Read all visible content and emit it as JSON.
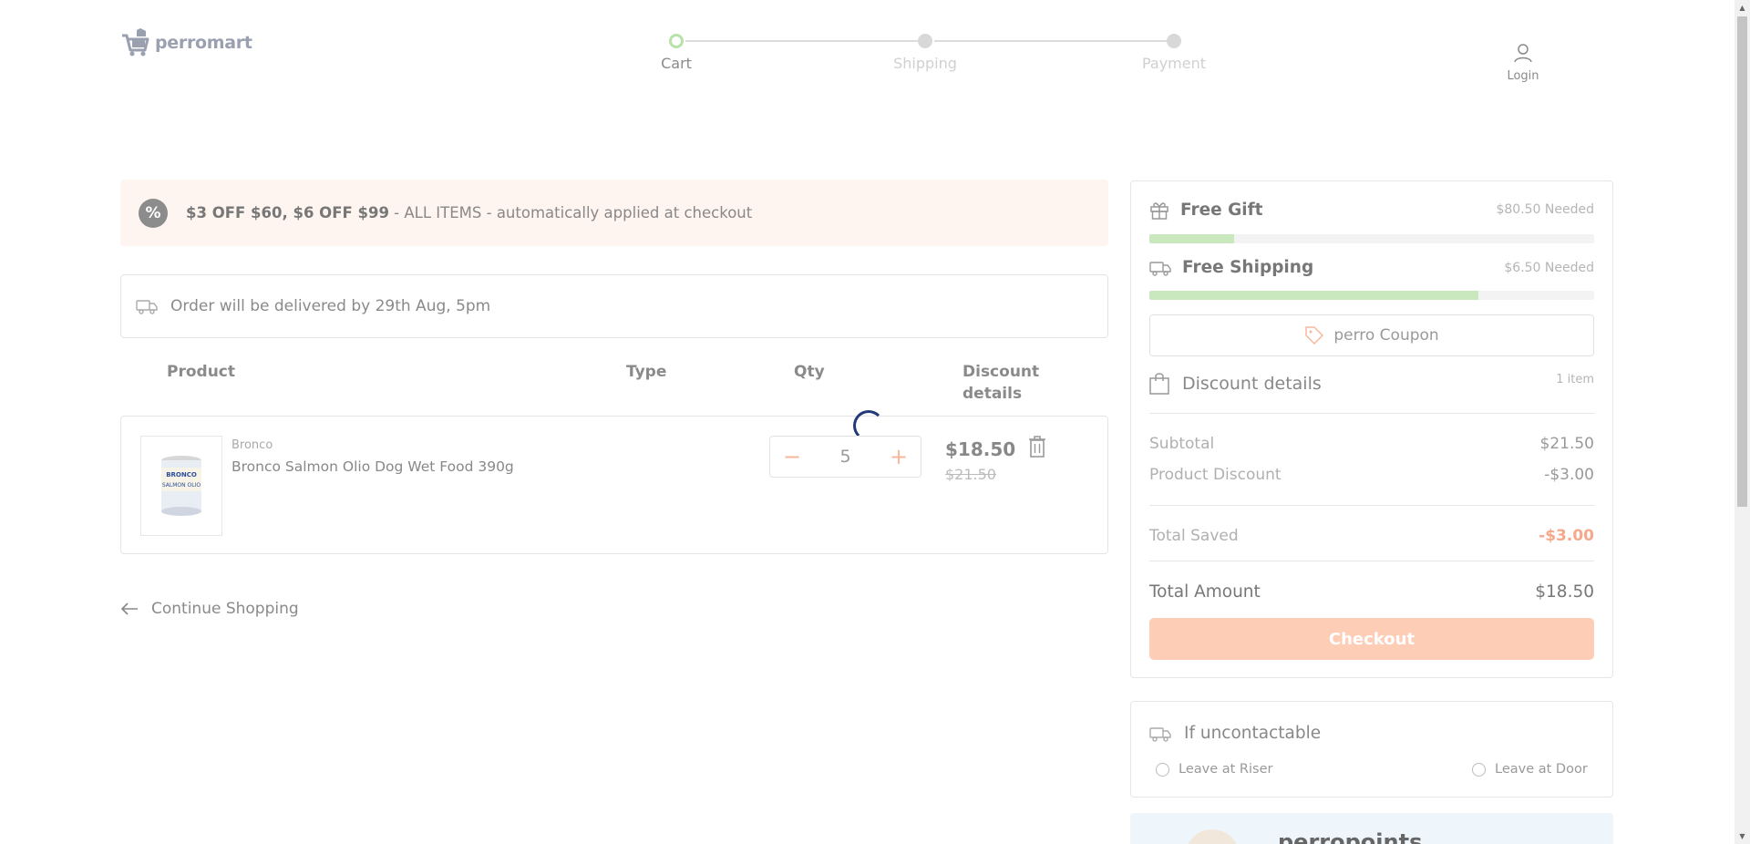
{
  "brand": {
    "name": "perromart"
  },
  "stepper": {
    "steps": [
      {
        "label": "Cart",
        "active": true
      },
      {
        "label": "Shipping",
        "active": false
      },
      {
        "label": "Payment",
        "active": false
      }
    ]
  },
  "header": {
    "login_label": "Login"
  },
  "promo": {
    "icon": "percent-icon",
    "bold_text": "$3 OFF $60, $6 OFF $99",
    "text": " - ALL ITEMS - automatically applied at checkout"
  },
  "delivery": {
    "icon": "truck-icon",
    "text": "Order will be delivered by 29th Aug, 5pm"
  },
  "cart_table": {
    "columns": [
      "Product",
      "Type",
      "Qty",
      "Discount details"
    ]
  },
  "cart_items": [
    {
      "brand": "Bronco",
      "name": "Bronco Salmon Olio Dog Wet Food 390g",
      "qty": "5",
      "price": "$18.50",
      "old_price": "$21.50",
      "image_label": "BRONCO SALMON OLIO"
    }
  ],
  "continue": {
    "label": "Continue Shopping"
  },
  "goals": [
    {
      "icon": "gift-icon",
      "title": "Free Gift",
      "needed": "$80.50 Needed",
      "progress": 0.19
    },
    {
      "icon": "truck-icon",
      "title": "Free Shipping",
      "needed": "$6.50 Needed",
      "progress": 0.74
    }
  ],
  "coupon": {
    "label": "perro Coupon"
  },
  "discount": {
    "title": "Discount details",
    "count": "1 item",
    "subtotal_label": "Subtotal",
    "subtotal": "$21.50",
    "product_discount_label": "Product Discount",
    "product_discount": "-$3.00",
    "total_saved_label": "Total Saved",
    "total_saved": "-$3.00",
    "total_label": "Total Amount",
    "total": "$18.50",
    "checkout_label": "Checkout"
  },
  "uncontactable": {
    "title": "If uncontactable",
    "options": [
      "Leave at Riser",
      "Leave at Door"
    ]
  },
  "points": {
    "title": "perropoints"
  },
  "colors": {
    "accent": "#fdcdb6",
    "progress": "#c9e8bd",
    "promo_bg": "#fff5f0"
  }
}
